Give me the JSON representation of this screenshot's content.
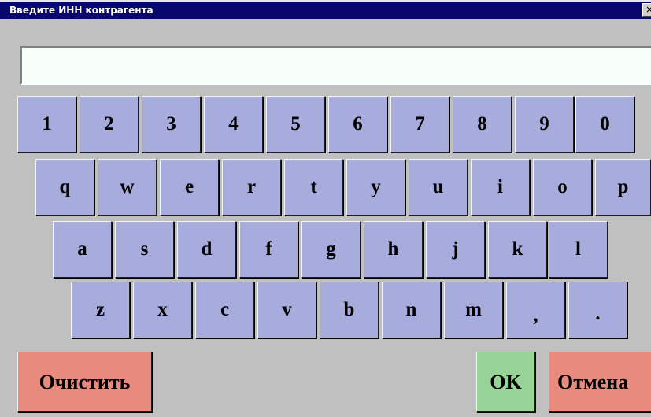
{
  "window": {
    "title": "Введите ИНН контрагента",
    "close_label": "×"
  },
  "input": {
    "value": ""
  },
  "keyboard": {
    "row1": [
      "1",
      "2",
      "3",
      "4",
      "5",
      "6",
      "7",
      "8",
      "9",
      "0"
    ],
    "row2": [
      "q",
      "w",
      "e",
      "r",
      "t",
      "y",
      "u",
      "i",
      "o",
      "p"
    ],
    "row3": [
      "a",
      "s",
      "d",
      "f",
      "g",
      "h",
      "j",
      "k",
      "l"
    ],
    "row4": [
      "z",
      "x",
      "c",
      "v",
      "b",
      "n",
      "m",
      ",",
      "."
    ]
  },
  "buttons": {
    "clear": "Очистить",
    "ok": "OK",
    "cancel": "Отмена"
  },
  "colors": {
    "key": "#a8acdc",
    "clear": "#e88a7e",
    "ok": "#98d498",
    "cancel": "#e88a7e",
    "titlebar": "#08086c"
  }
}
